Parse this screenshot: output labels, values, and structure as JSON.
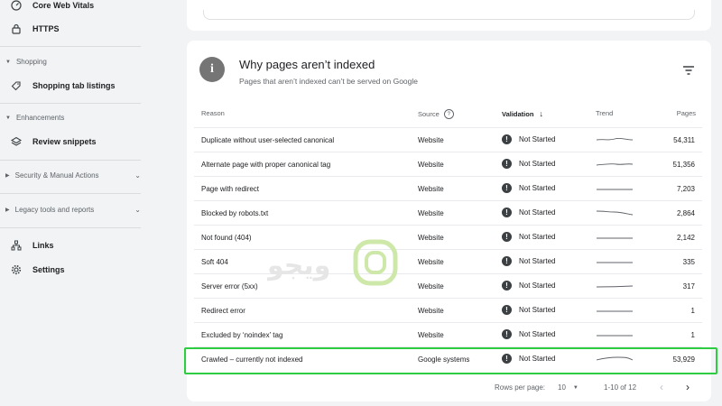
{
  "sidebar": {
    "items_top": [
      {
        "label": "Core Web Vitals",
        "icon": "gauge-icon"
      },
      {
        "label": "HTTPS",
        "icon": "lock-icon"
      }
    ],
    "shopping": {
      "header": "Shopping",
      "items": [
        {
          "label": "Shopping tab listings",
          "icon": "tag-icon"
        }
      ]
    },
    "enhancements": {
      "header": "Enhancements",
      "items": [
        {
          "label": "Review snippets",
          "icon": "layers-icon"
        }
      ]
    },
    "security": {
      "label": "Security & Manual Actions"
    },
    "legacy": {
      "label": "Legacy tools and reports"
    },
    "items_bottom": [
      {
        "label": "Links",
        "icon": "sitemap-icon"
      },
      {
        "label": "Settings",
        "icon": "gear-icon"
      }
    ]
  },
  "card": {
    "title": "Why pages aren’t indexed",
    "subtitle": "Pages that aren’t indexed can’t be served on Google"
  },
  "table": {
    "headers": {
      "reason": "Reason",
      "source": "Source",
      "validation": "Validation",
      "trend": "Trend",
      "pages": "Pages"
    },
    "rows": [
      {
        "reason": "Duplicate without user-selected canonical",
        "source": "Website",
        "validation": "Not Started",
        "pages": "54,311"
      },
      {
        "reason": "Alternate page with proper canonical tag",
        "source": "Website",
        "validation": "Not Started",
        "pages": "51,356"
      },
      {
        "reason": "Page with redirect",
        "source": "Website",
        "validation": "Not Started",
        "pages": "7,203"
      },
      {
        "reason": "Blocked by robots.txt",
        "source": "Website",
        "validation": "Not Started",
        "pages": "2,864"
      },
      {
        "reason": "Not found (404)",
        "source": "Website",
        "validation": "Not Started",
        "pages": "2,142"
      },
      {
        "reason": "Soft 404",
        "source": "Website",
        "validation": "Not Started",
        "pages": "335"
      },
      {
        "reason": "Server error (5xx)",
        "source": "Website",
        "validation": "Not Started",
        "pages": "317"
      },
      {
        "reason": "Redirect error",
        "source": "Website",
        "validation": "Not Started",
        "pages": "1"
      },
      {
        "reason": "Excluded by ‘noindex’ tag",
        "source": "Website",
        "validation": "Not Started",
        "pages": "1"
      },
      {
        "reason": "Crawled – currently not indexed",
        "source": "Google systems",
        "validation": "Not Started",
        "pages": "53,929"
      }
    ]
  },
  "pagination": {
    "rows_label": "Rows per page:",
    "rows_value": "10",
    "range": "1-10 of 12"
  },
  "colors": {
    "highlight": "#2ecc40",
    "accent": "#3c4043"
  }
}
